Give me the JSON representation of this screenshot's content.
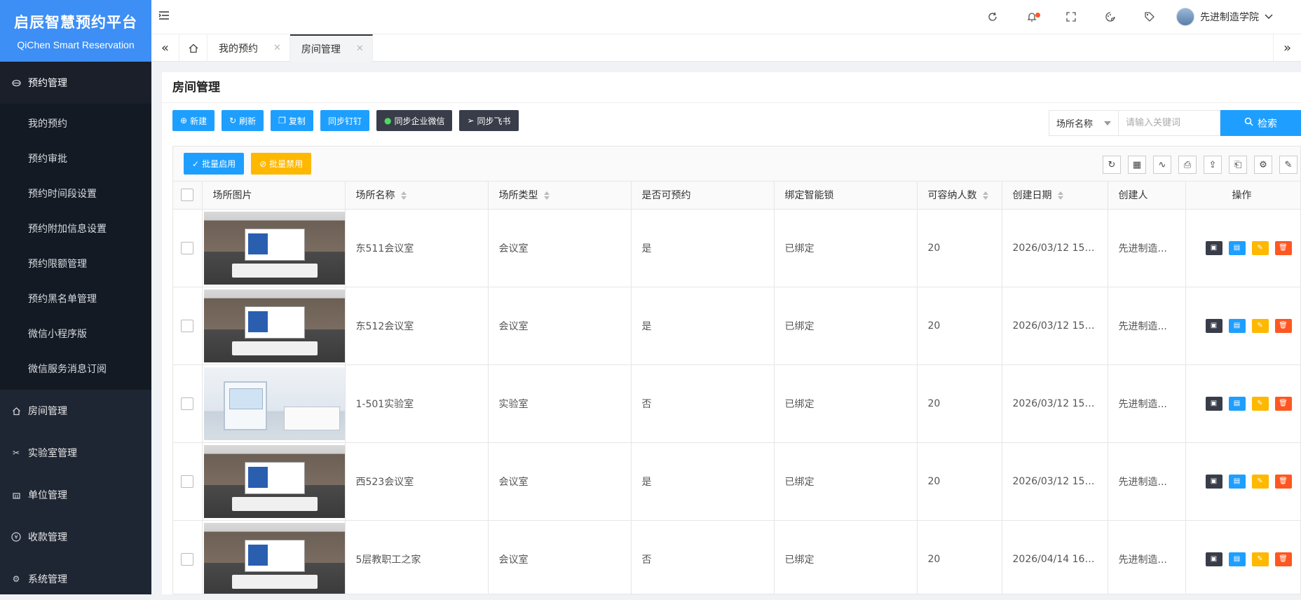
{
  "brand": {
    "title_cn": "启辰智慧预约平台",
    "title_en": "QiChen Smart Reservation"
  },
  "sidebar": {
    "groups": [
      {
        "label": "预约管理",
        "icon": "reservation-icon",
        "open": true,
        "items": [
          "我的预约",
          "预约审批",
          "预约时间段设置",
          "预约附加信息设置",
          "预约限额管理",
          "预约黑名单管理",
          "微信小程序版",
          "微信服务消息订阅"
        ]
      },
      {
        "label": "房间管理",
        "icon": "home-icon"
      },
      {
        "label": "实验室管理",
        "icon": "lab-icon"
      },
      {
        "label": "单位管理",
        "icon": "building-icon"
      },
      {
        "label": "收款管理",
        "icon": "yen-icon"
      },
      {
        "label": "系统管理",
        "icon": "gear-icon"
      }
    ]
  },
  "header": {
    "user_name": "先进制造学院",
    "icons": [
      "refresh-icon",
      "bell-icon",
      "fullscreen-icon",
      "theme-icon",
      "tag-icon"
    ]
  },
  "tabs": [
    {
      "label": "我的预约",
      "active": false
    },
    {
      "label": "房间管理",
      "active": true
    }
  ],
  "page": {
    "title": "房间管理"
  },
  "toolbar": {
    "new": "新建",
    "refresh": "刷新",
    "copy": "复制",
    "sync_dingtalk": "同步钉钉",
    "sync_wecom": "同步企业微信",
    "sync_feishu": "同步飞书"
  },
  "search": {
    "field_selected": "场所名称",
    "placeholder": "请输入关键词",
    "button": "检索"
  },
  "batch": {
    "enable": "批量启用",
    "disable": "批量禁用"
  },
  "table": {
    "columns": [
      "场所图片",
      "场所名称",
      "场所类型",
      "是否可预约",
      "绑定智能锁",
      "可容纳人数",
      "创建日期",
      "创建人",
      "操作"
    ],
    "rows": [
      {
        "image": "meeting",
        "name": "东511会议室",
        "type": "会议室",
        "bookable": "是",
        "lock": "已绑定",
        "capacity": "20",
        "created": "2026/03/12 15:4...",
        "creator": "先进制造..."
      },
      {
        "image": "meeting",
        "name": "东512会议室",
        "type": "会议室",
        "bookable": "是",
        "lock": "已绑定",
        "capacity": "20",
        "created": "2026/03/12 15:4...",
        "creator": "先进制造..."
      },
      {
        "image": "lab",
        "name": "1-501实验室",
        "type": "实验室",
        "bookable": "否",
        "lock": "已绑定",
        "capacity": "20",
        "created": "2026/03/12 15:4...",
        "creator": "先进制造..."
      },
      {
        "image": "meeting",
        "name": "西523会议室",
        "type": "会议室",
        "bookable": "是",
        "lock": "已绑定",
        "capacity": "20",
        "created": "2026/03/12 15:4...",
        "creator": "先进制造..."
      },
      {
        "image": "meeting",
        "name": "5层教职工之家",
        "type": "会议室",
        "bookable": "否",
        "lock": "已绑定",
        "capacity": "20",
        "created": "2026/04/14 16:4...",
        "creator": "先进制造..."
      }
    ]
  },
  "colors": {
    "primary": "#1e9fff",
    "dark": "#393d49",
    "warning": "#ffb800",
    "danger": "#ff5722",
    "sidebar": "#1f2633",
    "brand": "#3d8ef5"
  }
}
